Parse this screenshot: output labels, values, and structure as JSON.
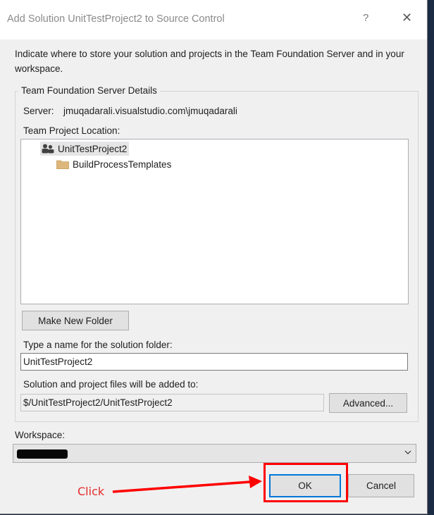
{
  "window": {
    "title": "Add Solution UnitTestProject2 to Source Control",
    "help_label": "?",
    "close_label": "✕"
  },
  "intro_text": "Indicate where to store your solution and projects in the Team Foundation Server and in your workspace.",
  "tfs_details": {
    "legend": "Team Foundation Server Details",
    "server_label": "Server:",
    "server_value": "jmuqadarali.visualstudio.com\\jmuqadarali",
    "location_label": "Team Project Location:",
    "tree": [
      {
        "label": "UnitTestProject2",
        "icon": "team-project-icon",
        "selected": true
      },
      {
        "label": "BuildProcessTemplates",
        "icon": "folder-icon",
        "selected": false
      }
    ],
    "make_new_folder_label": "Make New Folder",
    "solution_folder_label": "Type a name for the solution folder:",
    "solution_folder_value": "UnitTestProject2",
    "added_to_label": "Solution and project files will be added to:",
    "added_to_value": "$/UnitTestProject2/UnitTestProject2",
    "advanced_label": "Advanced..."
  },
  "workspace": {
    "label": "Workspace:",
    "value_redacted": true
  },
  "buttons": {
    "ok_label": "OK",
    "cancel_label": "Cancel"
  },
  "annotation": {
    "click_label": "Click",
    "color": "#ff0000"
  },
  "colors": {
    "accent": "#0078d7",
    "folder": "#dcb67a"
  }
}
